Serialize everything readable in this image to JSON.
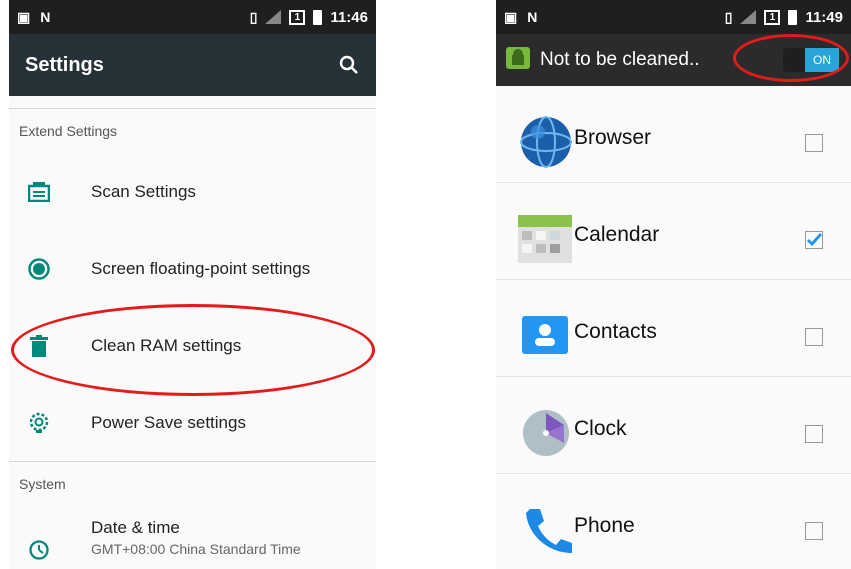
{
  "left_screen": {
    "status": {
      "time": "11:46",
      "sim_label": "1"
    },
    "appbar": {
      "title": "Settings"
    },
    "sections": [
      {
        "header": "Extend Settings",
        "items": [
          {
            "label": "Scan Settings",
            "icon": "scan-icon"
          },
          {
            "label": "Screen floating-point settings",
            "icon": "floating-point-icon"
          },
          {
            "label": "Clean RAM settings",
            "icon": "trash-icon"
          },
          {
            "label": "Power Save settings",
            "icon": "power-save-icon"
          }
        ]
      },
      {
        "header": "System",
        "items": [
          {
            "label": "Date & time",
            "sublabel": "GMT+08:00 China Standard Time",
            "icon": "clock-icon"
          }
        ]
      }
    ]
  },
  "right_screen": {
    "status": {
      "time": "11:49",
      "sim_label": "1"
    },
    "toolbar": {
      "title": "Not to be cleaned..",
      "toggle_label": "ON"
    },
    "apps": [
      {
        "name": "Browser",
        "checked": false,
        "icon": "browser-icon"
      },
      {
        "name": "Calendar",
        "checked": true,
        "icon": "calendar-icon"
      },
      {
        "name": "Contacts",
        "checked": false,
        "icon": "contacts-icon"
      },
      {
        "name": "Clock",
        "checked": false,
        "icon": "clock-app-icon"
      },
      {
        "name": "Phone",
        "checked": false,
        "icon": "phone-icon"
      }
    ]
  },
  "colors": {
    "appbar": "#263238",
    "accent": "#2aa4d8",
    "highlight": "#e31b1b",
    "icon_teal": "#00897b"
  }
}
